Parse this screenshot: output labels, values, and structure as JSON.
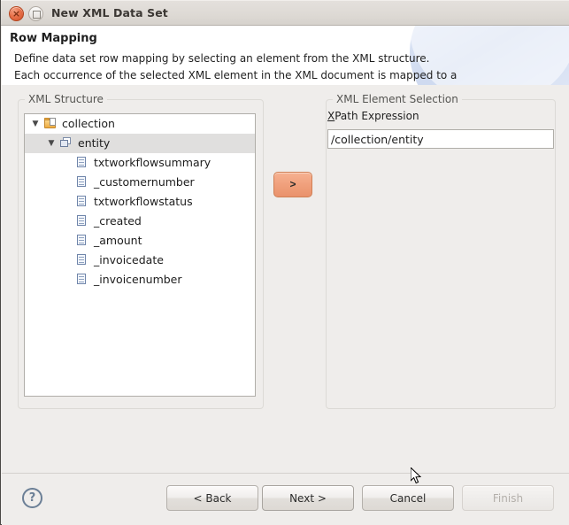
{
  "window": {
    "title": "New XML Data Set",
    "close_icon": "close-icon",
    "maximize_icon": "maximize-icon"
  },
  "header": {
    "title": "Row Mapping",
    "description": [
      "Define data set row mapping by selecting an element from the XML structure.",
      "Each occurrence of the selected XML element in the XML document is mapped to a"
    ]
  },
  "structure_group": {
    "label": "XML Structure",
    "tree": [
      {
        "label": "collection",
        "icon": "folder-collection-icon",
        "depth": 0,
        "twisty": "▼",
        "selected": false
      },
      {
        "label": "entity",
        "icon": "xml-element-icon",
        "depth": 1,
        "twisty": "▼",
        "selected": true
      },
      {
        "label": "txtworkflowsummary",
        "icon": "xml-leaf-icon",
        "depth": 2,
        "twisty": "",
        "selected": false
      },
      {
        "label": "_customernumber",
        "icon": "xml-leaf-icon",
        "depth": 2,
        "twisty": "",
        "selected": false
      },
      {
        "label": "txtworkflowstatus",
        "icon": "xml-leaf-icon",
        "depth": 2,
        "twisty": "",
        "selected": false
      },
      {
        "label": "_created",
        "icon": "xml-leaf-icon",
        "depth": 2,
        "twisty": "",
        "selected": false
      },
      {
        "label": "_amount",
        "icon": "xml-leaf-icon",
        "depth": 2,
        "twisty": "",
        "selected": false
      },
      {
        "label": "_invoicedate",
        "icon": "xml-leaf-icon",
        "depth": 2,
        "twisty": "",
        "selected": false
      },
      {
        "label": "_invoicenumber",
        "icon": "xml-leaf-icon",
        "depth": 2,
        "twisty": "",
        "selected": false
      }
    ]
  },
  "transfer": {
    "arrow_label": ">",
    "accent_color": "#f0a07c"
  },
  "selection_group": {
    "label": "XML Element Selection",
    "xpath_label_mnemonic": "X",
    "xpath_label_rest": "Path Expression",
    "xpath_value": "/collection/entity"
  },
  "footer": {
    "help_label": "?",
    "buttons": [
      {
        "label": "< Back",
        "enabled": true
      },
      {
        "label": "Next >",
        "enabled": true
      },
      {
        "label": "Cancel",
        "enabled": true
      },
      {
        "label": "Finish",
        "enabled": false
      }
    ]
  }
}
